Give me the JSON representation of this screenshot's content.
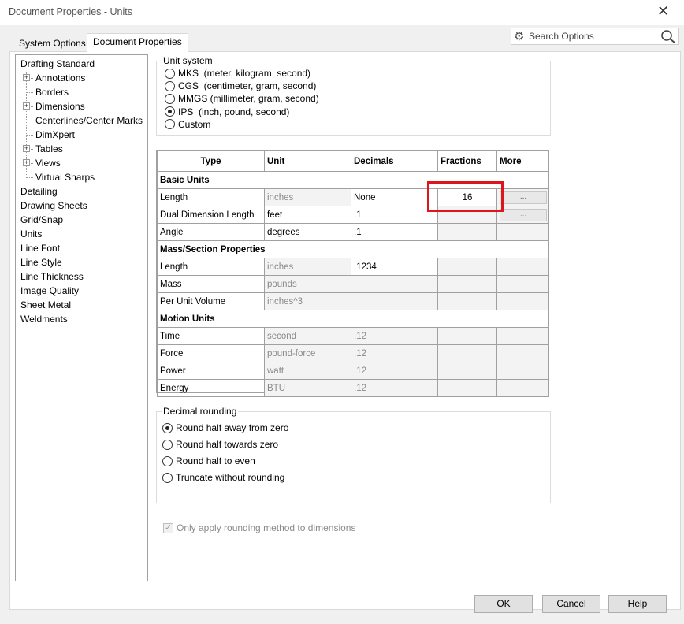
{
  "window": {
    "title": "Document Properties - Units",
    "close_glyph": "✕"
  },
  "tabs": [
    {
      "label": "System Options",
      "active": false
    },
    {
      "label": "Document Properties",
      "active": true
    }
  ],
  "search": {
    "placeholder": "Search Options",
    "left_icon": "gear-icon",
    "right_icon": "search-icon"
  },
  "tree": {
    "items": [
      {
        "label": "Drafting Standard",
        "level": 0,
        "expandable": false
      },
      {
        "label": "Annotations",
        "level": 1,
        "expandable": true
      },
      {
        "label": "Borders",
        "level": 1,
        "expandable": false
      },
      {
        "label": "Dimensions",
        "level": 1,
        "expandable": true
      },
      {
        "label": "Centerlines/Center Marks",
        "level": 1,
        "expandable": false
      },
      {
        "label": "DimXpert",
        "level": 1,
        "expandable": false
      },
      {
        "label": "Tables",
        "level": 1,
        "expandable": true
      },
      {
        "label": "Views",
        "level": 1,
        "expandable": true
      },
      {
        "label": "Virtual Sharps",
        "level": 1,
        "expandable": false
      },
      {
        "label": "Detailing",
        "level": 0,
        "expandable": false
      },
      {
        "label": "Drawing Sheets",
        "level": 0,
        "expandable": false
      },
      {
        "label": "Grid/Snap",
        "level": 0,
        "expandable": false
      },
      {
        "label": "Units",
        "level": 0,
        "expandable": false,
        "selected": true
      },
      {
        "label": "Line Font",
        "level": 0,
        "expandable": false
      },
      {
        "label": "Line Style",
        "level": 0,
        "expandable": false
      },
      {
        "label": "Line Thickness",
        "level": 0,
        "expandable": false
      },
      {
        "label": "Image Quality",
        "level": 0,
        "expandable": false
      },
      {
        "label": "Sheet Metal",
        "level": 0,
        "expandable": false
      },
      {
        "label": "Weldments",
        "level": 0,
        "expandable": false
      }
    ]
  },
  "unit_system": {
    "legend": "Unit system",
    "options": [
      {
        "label": "MKS  (meter, kilogram, second)",
        "checked": false
      },
      {
        "label": "CGS  (centimeter, gram, second)",
        "checked": false
      },
      {
        "label": "MMGS (millimeter, gram, second)",
        "checked": false
      },
      {
        "label": "IPS  (inch, pound, second)",
        "checked": true
      },
      {
        "label": "Custom",
        "checked": false
      }
    ]
  },
  "units_table": {
    "headers": [
      "Type",
      "Unit",
      "Decimals",
      "Fractions",
      "More"
    ],
    "more_button": "...",
    "sections": [
      {
        "title": "Basic Units",
        "rows": [
          {
            "type": "Length",
            "unit": "inches",
            "decimals": "None",
            "fractions": "16",
            "more": true,
            "unit_readonly": true,
            "fraction_editable": true
          },
          {
            "type": "Dual Dimension Length",
            "unit": "feet",
            "decimals": ".1",
            "fractions": "",
            "more": true,
            "more_faded": true,
            "unit_readonly": false
          },
          {
            "type": "Angle",
            "unit": "degrees",
            "decimals": ".1",
            "fractions": "",
            "more": false,
            "unit_readonly": false
          }
        ]
      },
      {
        "title": "Mass/Section Properties",
        "rows": [
          {
            "type": "Length",
            "unit": "inches",
            "decimals": ".1234",
            "fractions": "",
            "more": false,
            "unit_readonly": true
          },
          {
            "type": "Mass",
            "unit": "pounds",
            "decimals": "",
            "fractions": "",
            "more": false,
            "unit_readonly": true
          },
          {
            "type": "Per Unit Volume",
            "unit": "inches^3",
            "decimals": "",
            "fractions": "",
            "more": false,
            "unit_readonly": true
          }
        ]
      },
      {
        "title": "Motion Units",
        "rows": [
          {
            "type": "Time",
            "unit": "second",
            "decimals": ".12",
            "fractions": "",
            "more": false,
            "unit_readonly": true,
            "dec_readonly": true
          },
          {
            "type": "Force",
            "unit": "pound-force",
            "decimals": ".12",
            "fractions": "",
            "more": false,
            "unit_readonly": true,
            "dec_readonly": true
          },
          {
            "type": "Power",
            "unit": "watt",
            "decimals": ".12",
            "fractions": "",
            "more": false,
            "unit_readonly": true,
            "dec_readonly": true
          },
          {
            "type": "Energy",
            "unit": "BTU",
            "decimals": ".12",
            "fractions": "",
            "more": false,
            "unit_readonly": true,
            "dec_readonly": true
          }
        ]
      }
    ]
  },
  "decimal_rounding": {
    "legend": "Decimal rounding",
    "options": [
      {
        "label": "Round half away from zero",
        "checked": true
      },
      {
        "label": "Round half towards zero",
        "checked": false
      },
      {
        "label": "Round half to even",
        "checked": false
      },
      {
        "label": "Truncate without rounding",
        "checked": false
      }
    ]
  },
  "apply_rounding_checkbox": {
    "label": "Only apply rounding method to dimensions",
    "checked": true,
    "disabled": true
  },
  "buttons": {
    "ok": "OK",
    "cancel": "Cancel",
    "help": "Help"
  },
  "colors": {
    "highlight": "#e0141d",
    "dialog_bg": "#f0f0f0"
  }
}
